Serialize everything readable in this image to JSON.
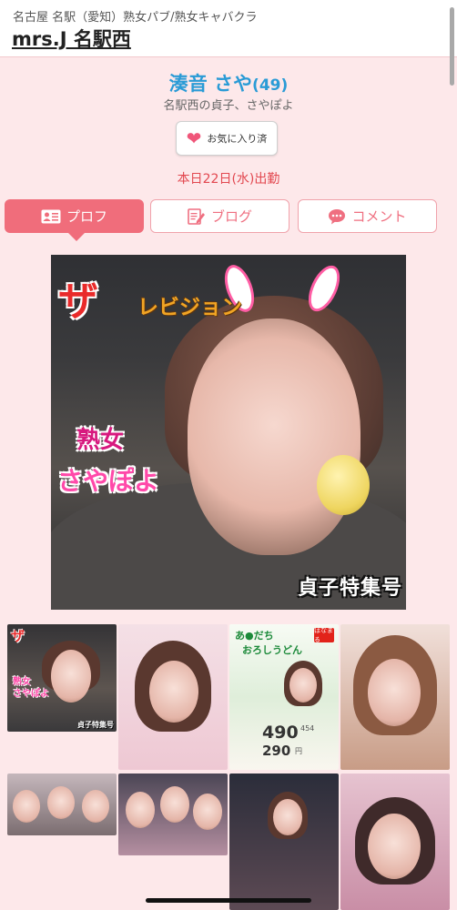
{
  "header": {
    "subtitle": "名古屋 名駅（愛知）熟女パブ/熟女キャバクラ",
    "shop_name": "mrs.J 名駅西"
  },
  "profile": {
    "name": "湊音 さや",
    "age": "(49)",
    "catchphrase": "名駅西の貞子、さやぽよ",
    "favorite_label": "お気に入り済",
    "shift": "本日22日(水)出勤"
  },
  "tabs": [
    {
      "label": "プロフ",
      "icon": "profile-card-icon",
      "active": true
    },
    {
      "label": "ブログ",
      "icon": "blog-edit-icon",
      "active": false
    },
    {
      "label": "コメント",
      "icon": "comment-bubble-icon",
      "active": false
    }
  ],
  "main_photo": {
    "logo_za": "ザ",
    "logo_rest": "レビジョン",
    "title_line1": "熟女",
    "title_line2": "さやぽよ",
    "special": "貞子特集号"
  },
  "thumbnails": {
    "t1": {
      "za": "ザ",
      "name": "熟女\nさやぽよ",
      "special": "貞子特集号"
    },
    "t3": {
      "cap1": "あ●だち",
      "cap2": "おろしうどん",
      "logo": "はなまる",
      "price1": "490",
      "price2": "290",
      "sub1": "454",
      "sub2": "円"
    }
  },
  "colors": {
    "accent_pink": "#f06d7b",
    "name_blue": "#2a9bd6",
    "shift_red": "#e2474f",
    "page_bg": "#fde8ea"
  }
}
